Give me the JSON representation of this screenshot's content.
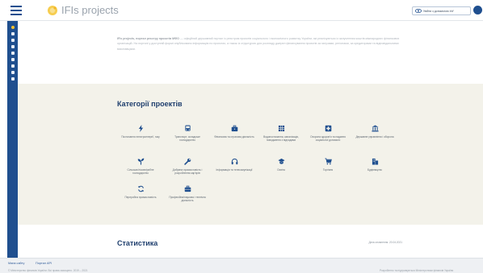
{
  "header": {
    "brand": "IFIs projects",
    "login_label": "Увійти з допомогою ІнУ"
  },
  "sidebar": {
    "items": [
      {
        "icon": "star-icon",
        "active": true
      },
      {
        "icon": "search-icon"
      },
      {
        "icon": "list-icon"
      },
      {
        "icon": "document-icon"
      },
      {
        "icon": "edit-icon"
      },
      {
        "icon": "chart-icon"
      },
      {
        "icon": "map-icon"
      },
      {
        "icon": "link-icon"
      },
      {
        "icon": "info-icon"
      }
    ]
  },
  "intro": {
    "lead": "IFIs projects, портал реєстру проєктів МФО",
    "text": " — офіційний державний портал із реєстром проєктів соціального і економічного розвитку України, які реалізуються із залученням коштів міжнародних фінансових організацій. На порталі у доступній формі опубліковано інформацію по проєктах, а також із структурою для розгляду джерел фінансування проєктів за галузями, регіонами, за кредиторами та відповідальними виконавцями."
  },
  "categories": {
    "title": "Категорії проектів",
    "items": [
      {
        "icon": "lightning-icon",
        "label": "Постачання електроенергії, газу"
      },
      {
        "icon": "bus-icon",
        "label": "Транспорт, складське господарство"
      },
      {
        "icon": "briefcase-icon",
        "label": "Фінансова та страхова діяльність"
      },
      {
        "icon": "building-grid-icon",
        "label": "Водопостачання, каналізація, поводження з відходами"
      },
      {
        "icon": "medical-cross-icon",
        "label": "Охорона здоров'я та надання соціальної допомоги"
      },
      {
        "icon": "government-icon",
        "label": "Державне управління і оборона"
      },
      {
        "icon": "seedling-icon",
        "label": "Сільське/лісове/рибне господарство"
      },
      {
        "icon": "wrench-icon",
        "label": "Добувна промисловість і розроблення кар'єрів"
      },
      {
        "icon": "headphones-icon",
        "label": "Інформація та телекомунікації"
      },
      {
        "icon": "education-icon",
        "label": "Освіта"
      },
      {
        "icon": "cart-icon",
        "label": "Торгівля"
      },
      {
        "icon": "buildings-icon",
        "label": "Будівництво"
      },
      {
        "icon": "refresh-icon",
        "label": "Переробна промисловість"
      },
      {
        "icon": "case-icon",
        "label": "Професійна/наукова і технічна діяльність"
      }
    ]
  },
  "stats": {
    "title": "Статистика",
    "date": "Дата оновлення: 20.04.2021"
  },
  "footer": {
    "link1": "Мапа сайту",
    "link2": "Портал API",
    "copyright": "© Міністерство фінансів України. Всі права захищено. 2019 – 2021",
    "developer": "Розроблено та підтримується Міністерством фінансів України"
  },
  "colors": {
    "brand_blue": "#1f4f8f",
    "band_background": "#f3f2ea",
    "accent_yellow": "#f2c230",
    "heading": "#1f3f6e"
  }
}
